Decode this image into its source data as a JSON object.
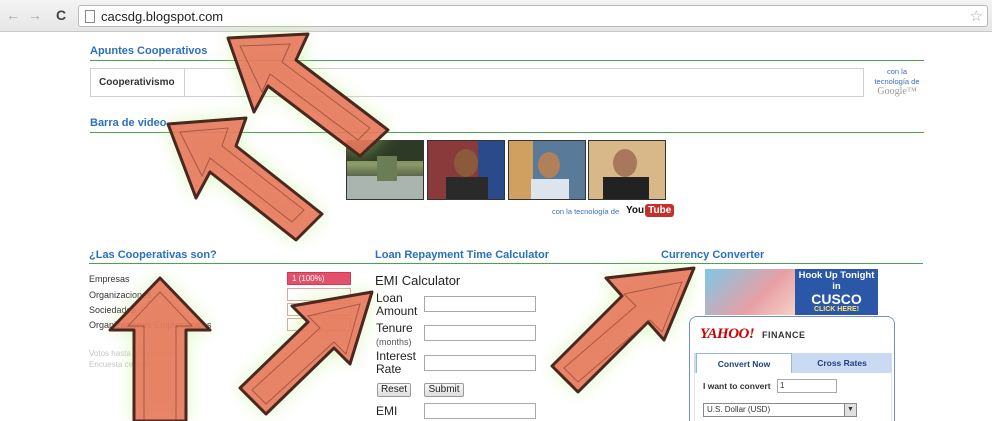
{
  "browser": {
    "back_icon": "←",
    "forward_icon": "→",
    "reload_icon": "C",
    "url": "cacsdg.blogspot.com",
    "star_icon": "☆"
  },
  "headers": {
    "apuntes": "Apuntes Cooperativos",
    "barra": "Barra de video",
    "cooperativas": "¿Las Cooperativas son?",
    "loan": "Loan Repayment Time Calculator",
    "currency": "Currency Converter"
  },
  "search": {
    "tab_label": "Cooperativismo",
    "powered_line1": "con la",
    "powered_line2": "tecnología de",
    "powered_google": "Google™"
  },
  "video_bar": {
    "caption": "con la tecnología de",
    "logo_you": "You",
    "logo_tube": "Tube"
  },
  "poll": {
    "options": [
      "Empresas",
      "Organizaciones",
      "Sociedades",
      "Organizaciones Empresariales"
    ],
    "first_result": "1 (100%)",
    "footer1": "Votos hasta el momento: 1",
    "footer2": "Encuesta cerrada"
  },
  "calculator": {
    "title": "EMI Calculator",
    "loan_label": "Loan Amount",
    "tenure_label": "Tenure",
    "tenure_unit": "(months)",
    "rate_label": "Interest Rate",
    "reset_label": "Reset",
    "submit_label": "Submit",
    "emi_label": "EMI"
  },
  "ad": {
    "line1": "Hook Up Tonight in",
    "line2": "CUSCO",
    "line3": "CLICK HERE!"
  },
  "yahoo_finance": {
    "brand": "YAHOO!",
    "product": "FINANCE",
    "tab_convert": "Convert Now",
    "tab_cross": "Cross Rates",
    "convert_label": "I want to convert",
    "amount_value": "1",
    "currency_value": "U.S. Dollar (USD)"
  },
  "colors": {
    "link_blue": "#2a6fc0",
    "rule_green": "#49a44b",
    "arrow_fill": "#e8735a",
    "arrow_glow": "#b5f07a"
  }
}
